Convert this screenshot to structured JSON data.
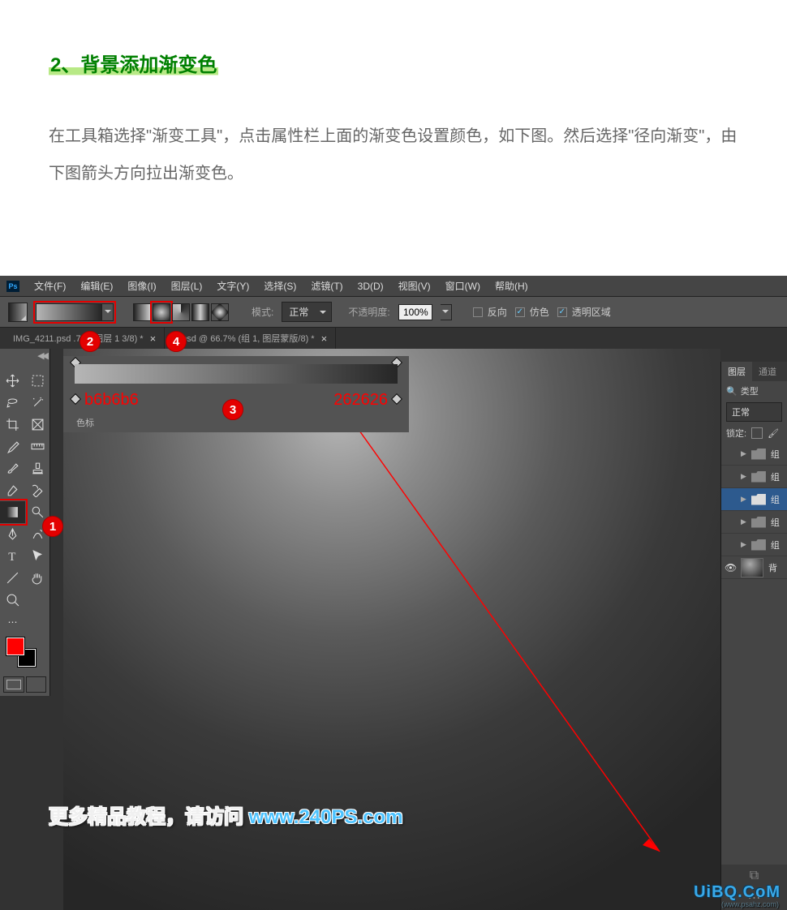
{
  "article": {
    "step_title": "2、背景添加渐变色",
    "step_desc": "在工具箱选择\"渐变工具\"，点击属性栏上面的渐变色设置颜色，如下图。然后选择\"径向渐变\"，由下图箭头方向拉出渐变色。"
  },
  "ps": {
    "logo": "Ps",
    "menu": [
      "文件(F)",
      "编辑(E)",
      "图像(I)",
      "图层(L)",
      "文字(Y)",
      "选择(S)",
      "滤镜(T)",
      "3D(D)",
      "视图(V)",
      "窗口(W)",
      "帮助(H)"
    ],
    "options": {
      "mode_label": "模式:",
      "mode_value": "正常",
      "opacity_label": "不透明度:",
      "opacity_value": "100%",
      "reverse": "反向",
      "dither": "仿色",
      "transparency": "透明区域"
    },
    "tabs": [
      "IMG_4211.psd       .7% (图层 1     3/8) *",
      "jc.psd @ 66.7% (组 1, 图层蒙版/8) *"
    ],
    "gradient": {
      "left_color": "b6b6b6",
      "right_color": "262626",
      "stop_label": "色标"
    },
    "right_panel": {
      "tab_layers": "图层",
      "tab_channels": "通道",
      "search": "类型",
      "blend": "正常",
      "lock": "锁定:",
      "layers": [
        "组",
        "组",
        "组",
        "组",
        "组"
      ],
      "bg_layer": "背"
    },
    "badges": {
      "b1": "1",
      "b2": "2",
      "b3": "3",
      "b4": "4"
    }
  },
  "watermark": {
    "prefix": "更多精品教程，请访问 ",
    "url": "www.240PS.com",
    "corner": "UiBQ.CoM",
    "corner_sub": "(www.psahz.com)"
  }
}
